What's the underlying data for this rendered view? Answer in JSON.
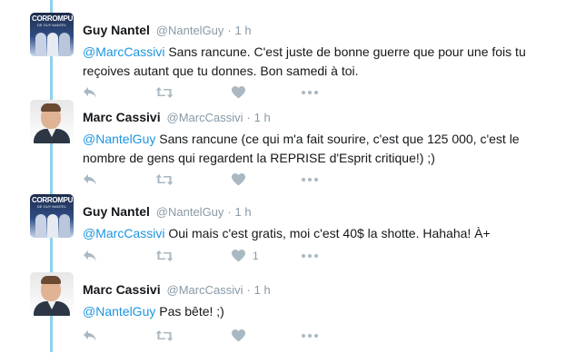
{
  "tweets": [
    {
      "author_name": "Guy Nantel",
      "handle": "@NantelGuy",
      "separator": "·",
      "time": "1 h",
      "avatar": "guy-nantel-avatar",
      "avatar_text": "CORROMPU",
      "avatar_subtext": "DE GUY NANTEL",
      "mention": "@MarcCassivi",
      "body": " Sans rancune. C'est juste de bonne guerre que pour une fois tu reçoives autant que tu donnes. Bon samedi à toi.",
      "like_count": ""
    },
    {
      "author_name": "Marc Cassivi",
      "handle": "@MarcCassivi",
      "separator": "·",
      "time": "1 h",
      "avatar": "marc-cassivi-avatar",
      "mention": "@NantelGuy",
      "body": " Sans rancune (ce qui m'a fait sourire, c'est que 125 000, c'est le nombre de gens qui regardent la REPRISE d'Esprit critique!) ;)",
      "like_count": ""
    },
    {
      "author_name": "Guy Nantel",
      "handle": "@NantelGuy",
      "separator": "·",
      "time": "1 h",
      "avatar": "guy-nantel-avatar",
      "avatar_text": "CORROMPU",
      "avatar_subtext": "DE GUY NANTEL",
      "mention": "@MarcCassivi",
      "body": " Oui mais c'est gratis, moi c'est 40$ la shotte. Hahaha! À+",
      "like_count": "1"
    },
    {
      "author_name": "Marc Cassivi",
      "handle": "@MarcCassivi",
      "separator": "·",
      "time": "1 h",
      "avatar": "marc-cassivi-avatar",
      "mention": "@NantelGuy",
      "body": " Pas bête! ;)",
      "like_count": ""
    }
  ],
  "icons": {
    "reply": "reply-icon",
    "retweet": "retweet-icon",
    "like": "heart-icon",
    "more": "more-dots-icon"
  },
  "colors": {
    "thread_line": "#8fd0ee",
    "mention": "#1b95e0",
    "muted": "#8899a6",
    "action_icon": "#aab8c2"
  }
}
